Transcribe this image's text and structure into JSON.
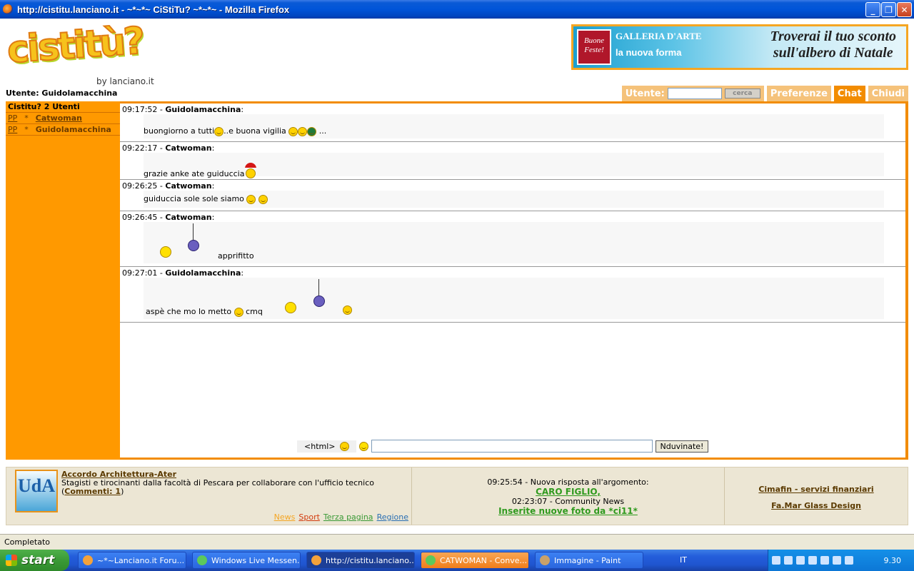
{
  "window": {
    "title": "http://cistitu.lanciano.it - ~*~*~ CiStiTu? ~*~*~ - Mozilla Firefox",
    "min": "_",
    "max": "❐",
    "close": "✕"
  },
  "header": {
    "logo_text": "cistitù?",
    "byline": "by lanciano.it",
    "current_user_label": "Utente: Guidolamacchina"
  },
  "banner": {
    "badge": "Buone Feste!",
    "gallery": "GALLERIA D'ARTE",
    "tagline": "la nuova forma",
    "promo_line1": "Troverai il tuo sconto",
    "promo_line2": "sull'albero di Natale"
  },
  "toolbar": {
    "utente_label": "Utente:",
    "utente_value": "",
    "cerca_label": "cerca",
    "preferenze": "Preferenze",
    "chat": "Chat",
    "chiudi": "Chiudi"
  },
  "sidebar": {
    "header": "Cistitu? 2 Utenti",
    "users": [
      {
        "pp": "PP",
        "star": "*",
        "name": "Catwoman"
      },
      {
        "pp": "PP",
        "star": "*",
        "name": "Guidolamacchina"
      }
    ]
  },
  "messages": [
    {
      "time": "09:17:52",
      "author": "Guidolamacchina",
      "text_a": "buongiorno a tutti",
      "text_b": "..e buona vigilia",
      "text_c": "..."
    },
    {
      "time": "09:22:17",
      "author": "Catwoman",
      "text_a": "grazie anke ate guiduccia"
    },
    {
      "time": "09:26:25",
      "author": "Catwoman",
      "text_a": "guiduccia sole sole siamo"
    },
    {
      "time": "09:26:45",
      "author": "Catwoman",
      "text_a": "apprifitto"
    },
    {
      "time": "09:27:01",
      "author": "Guidolamacchina",
      "text_a": "aspè che mo lo metto",
      "text_b": "cmq"
    }
  ],
  "composer": {
    "html_label": "<html>",
    "input_value": "",
    "send_label": "Nduvinate!"
  },
  "footer": {
    "logo": "UdA",
    "news_title": "Accordo Architettura-Ater",
    "news_text": "Stagisti e tirocinanti dalla facoltà di Pescara per collaborare con l'ufficio tecnico",
    "comments": "Commenti: 1",
    "categories": [
      {
        "label": "News",
        "color": "#f5a623"
      },
      {
        "label": "Sport",
        "color": "#d33a0c"
      },
      {
        "label": "Terza pagina",
        "color": "#3a9a36"
      },
      {
        "label": "Regione",
        "color": "#2a6fb3"
      }
    ],
    "forum_line": "09:25:54 - Nuova risposta all'argomento:",
    "forum_link": "CARO FIGLIO,",
    "community_line": "02:23:07 - Community News",
    "community_link": "Inserite nuove foto da *ci11*",
    "sponsor1": "Cimafin - servizi finanziari",
    "sponsor2": "Fa.Mar Glass Design"
  },
  "status": {
    "text": "Completato"
  },
  "taskbar": {
    "start": "start",
    "tasks": [
      {
        "label": "~*~Lanciano.it Foru...",
        "state": "normal"
      },
      {
        "label": "Windows Live Messen...",
        "state": "normal"
      },
      {
        "label": "http://cistitu.lanciano....",
        "state": "active"
      },
      {
        "label": "CATWOMAN - Conve...",
        "state": "flash"
      },
      {
        "label": "Immagine - Paint",
        "state": "normal"
      }
    ],
    "lang": "IT",
    "clock": "9.30"
  }
}
